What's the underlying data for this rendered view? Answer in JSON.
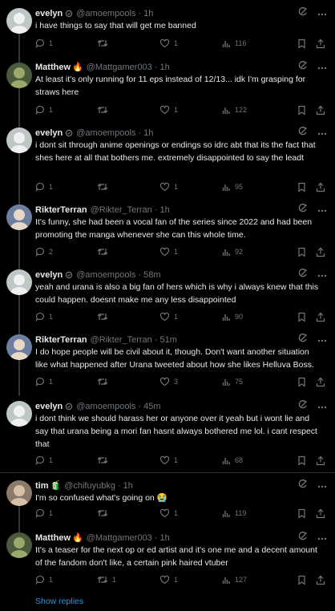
{
  "tweets": [
    {
      "name": "evelyn",
      "emoji": "",
      "verified": true,
      "handle": "@amoempools",
      "time": "1h",
      "text": "i have things to say that will get me banned",
      "replies": "1",
      "retweets": "",
      "likes": "1",
      "views": "116"
    },
    {
      "name": "Matthew",
      "emoji": "🔥",
      "verified": false,
      "handle": "@Mattgamer003",
      "time": "1h",
      "text": "At least it's only running for 11 eps instead of 12/13... idk I'm grasping for straws here",
      "replies": "1",
      "retweets": "",
      "likes": "1",
      "views": "122"
    },
    {
      "name": "evelyn",
      "emoji": "",
      "verified": true,
      "handle": "@amoempools",
      "time": "1h",
      "text": "i dont sit through anime openings or endings so idrc abt that its the fact that shes here at all that bothers me. extremely disappointed to say the leadt",
      "replies": "1",
      "retweets": "",
      "likes": "1",
      "views": "95"
    },
    {
      "name": "RikterTerran",
      "emoji": "",
      "verified": false,
      "handle": "@Rikter_Terran",
      "time": "1h",
      "text": "It's funny, she had been a vocal fan of the series since 2022 and had been promoting the manga whenever she can this whole time.",
      "replies": "2",
      "retweets": "",
      "likes": "1",
      "views": "92"
    },
    {
      "name": "evelyn",
      "emoji": "",
      "verified": true,
      "handle": "@amoempools",
      "time": "58m",
      "text": "yeah and urana is also a big fan of hers which is why i always knew that this could happen. doesnt make me any less disappointed",
      "replies": "1",
      "retweets": "",
      "likes": "1",
      "views": "90"
    },
    {
      "name": "RikterTerran",
      "emoji": "",
      "verified": false,
      "handle": "@Rikter_Terran",
      "time": "51m",
      "text": "I do hope people will be civil about it, though. Don't want another situation like what happened after Urana tweeted about how she likes Helluva Boss.",
      "replies": "1",
      "retweets": "",
      "likes": "3",
      "views": "75"
    },
    {
      "name": "evelyn",
      "emoji": "",
      "verified": true,
      "handle": "@amoempools",
      "time": "45m",
      "text": "i dont think we should harass her or anyone over it yeah but i wont lie and say that urana being a mori fan hasnt always bothered me lol. i cant respect that",
      "replies": "1",
      "retweets": "",
      "likes": "1",
      "views": "68"
    },
    {
      "name": "tim",
      "emoji": "🧃",
      "verified": false,
      "handle": "@chifuyubkg",
      "time": "1h",
      "text": "I'm so confused what's going on 😭",
      "replies": "1",
      "retweets": "",
      "likes": "1",
      "views": "119"
    },
    {
      "name": "Matthew",
      "emoji": "🔥",
      "verified": false,
      "handle": "@Mattgamer003",
      "time": "1h",
      "text": "It's a teaser for the next op or ed artist and it's one me and a decent amount of the fandom don't like, a certain pink haired vtuber",
      "replies": "1",
      "retweets": "1",
      "likes": "1",
      "views": "127"
    }
  ],
  "show_replies_label": "Show replies",
  "colors": {
    "background": "#000000",
    "text": "#e7e9ea",
    "secondary": "#71767b",
    "link": "#1d9bf0",
    "divider": "#2f3336",
    "thread_line": "#333639"
  },
  "icons": {
    "grok": "grok-icon",
    "more": "more-icon",
    "reply": "reply-icon",
    "retweet": "retweet-icon",
    "like": "like-icon",
    "views": "views-icon",
    "bookmark": "bookmark-icon",
    "share": "share-icon"
  }
}
